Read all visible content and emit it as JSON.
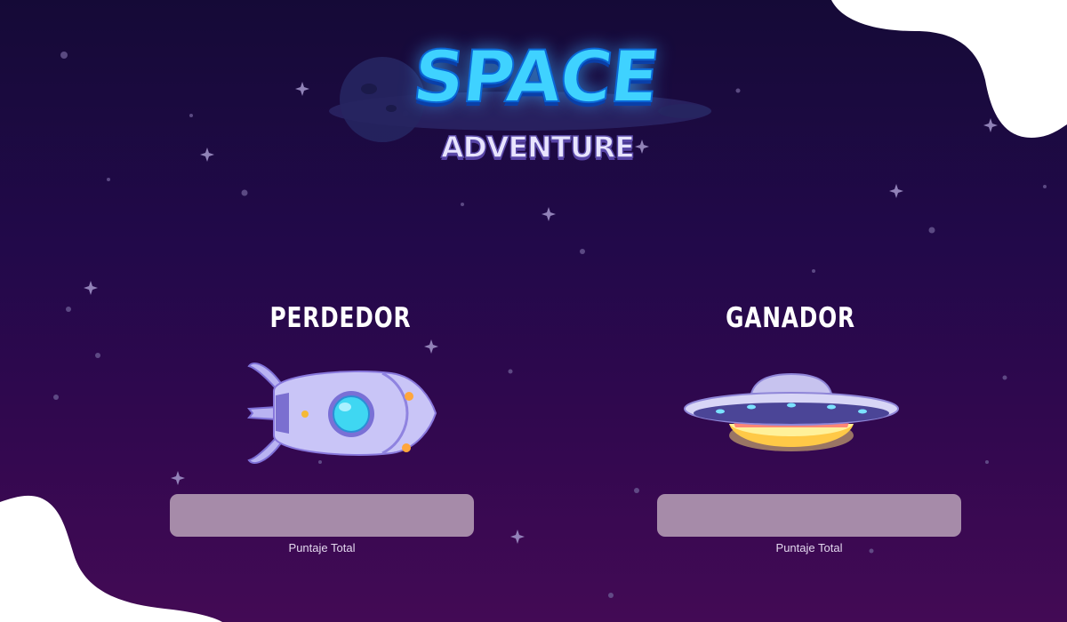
{
  "logo": {
    "line1": "SPACE",
    "line2": "ADVENTURE"
  },
  "players": {
    "loser": {
      "title": "PERDEDOR",
      "score_label": "Puntaje Total",
      "score_value": ""
    },
    "winner": {
      "title": "GANADOR",
      "score_label": "Puntaje Total",
      "score_value": ""
    }
  },
  "colors": {
    "background_top": "#150a37",
    "background_bottom": "#430a55",
    "score_box": "#a68ba9",
    "logo_blue": "#3fd2ff"
  },
  "icons": {
    "loser": "rocket-icon",
    "winner": "ufo-icon"
  }
}
